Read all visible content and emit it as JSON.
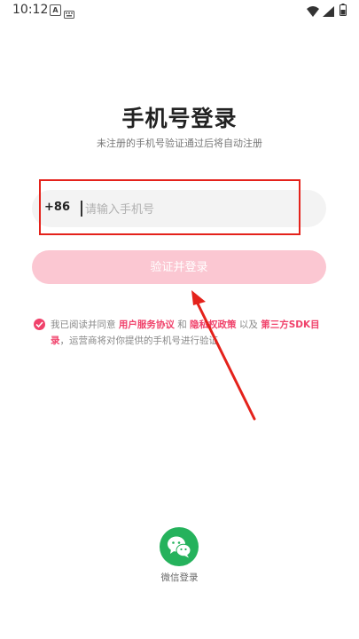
{
  "status_bar": {
    "time": "10:12",
    "icons": [
      "a-icon",
      "keyboard-icon",
      "wifi-icon",
      "signal-icon",
      "battery-icon"
    ]
  },
  "page": {
    "title": "手机号登录",
    "subtitle": "未注册的手机号验证通过后将自动注册"
  },
  "phone": {
    "country_code": "+86",
    "placeholder": "请输入手机号",
    "value": ""
  },
  "login_button": {
    "label": "验证并登录",
    "color": "#fbc7d2"
  },
  "agreement": {
    "checked": true,
    "prefix": "我已阅读并同意",
    "link_user": "用户服务协议",
    "and": "和",
    "link_privacy": "隐私权政策",
    "and2": "以及",
    "link_sdk": "第三方SDK目录",
    "suffix": "，运营商将对你提供的手机号进行验证",
    "accent_color": "#f0426b"
  },
  "wechat": {
    "label": "微信登录",
    "color": "#25b25c"
  },
  "annotation": {
    "color": "#e4221b"
  }
}
